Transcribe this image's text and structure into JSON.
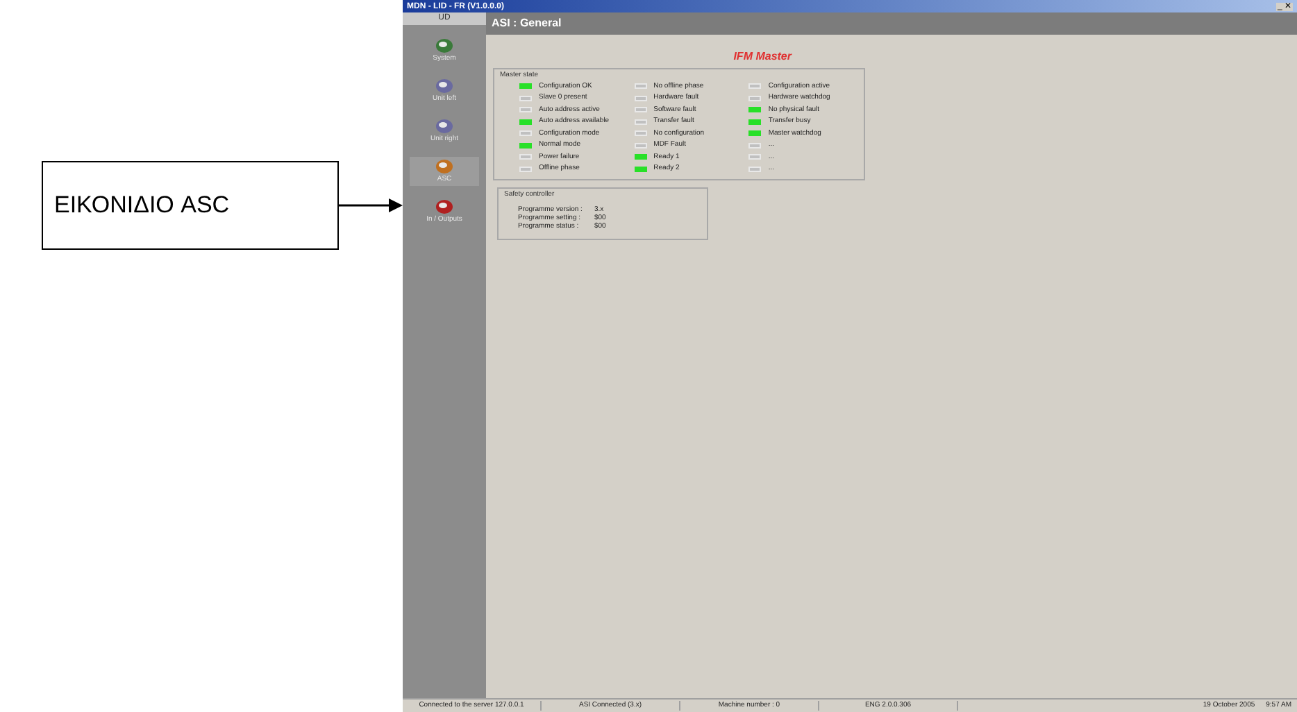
{
  "callout": {
    "label": "ΕΙΚΟΝΙΔΙΟ ASC"
  },
  "window": {
    "title": "MDN - LID - FR (V1.0.0.0)",
    "controls": "_ ✕"
  },
  "sidebar": {
    "header": "UD",
    "items": [
      {
        "label": "System",
        "selected": false
      },
      {
        "label": "Unit left",
        "selected": false
      },
      {
        "label": "Unit right",
        "selected": false
      },
      {
        "label": "ASC",
        "selected": true
      },
      {
        "label": "In / Outputs",
        "selected": false
      }
    ]
  },
  "page_header": "ASI : General",
  "brand": "IFM Master",
  "master_state": {
    "title": "Master state",
    "columns": [
      [
        {
          "label": "Configuration OK",
          "on": true
        },
        {
          "label": "Slave 0 present",
          "on": false
        },
        {
          "label": "Auto address active",
          "on": false
        },
        {
          "label": "Auto address available",
          "on": true
        },
        {
          "label": "Configuration mode",
          "on": false
        },
        {
          "label": "Normal mode",
          "on": true
        },
        {
          "label": "Power failure",
          "on": false
        },
        {
          "label": "Offline phase",
          "on": false
        }
      ],
      [
        {
          "label": "No offline phase",
          "on": false
        },
        {
          "label": "Hardware fault",
          "on": false
        },
        {
          "label": "Software fault",
          "on": false
        },
        {
          "label": "Transfer fault",
          "on": false
        },
        {
          "label": "No configuration",
          "on": false
        },
        {
          "label": "MDF Fault",
          "on": false
        },
        {
          "label": "Ready 1",
          "on": true
        },
        {
          "label": "Ready 2",
          "on": true
        }
      ],
      [
        {
          "label": "Configuration active",
          "on": false
        },
        {
          "label": "Hardware watchdog",
          "on": false
        },
        {
          "label": "No physical fault",
          "on": true
        },
        {
          "label": "Transfer busy",
          "on": true
        },
        {
          "label": "Master watchdog",
          "on": true
        },
        {
          "label": "...",
          "on": false
        },
        {
          "label": "...",
          "on": false
        },
        {
          "label": "...",
          "on": false
        }
      ]
    ]
  },
  "safety_controller": {
    "title": "Safety controller",
    "rows": [
      {
        "label": "Programme version :",
        "value": "3.x"
      },
      {
        "label": "Programme setting :",
        "value": "$00"
      },
      {
        "label": "Programme status :",
        "value": "$00"
      }
    ]
  },
  "status_bar": [
    "Connected to the server 127.0.0.1",
    "ASI Connected (3.x)",
    "Machine number : 0",
    "ENG 2.0.0.306",
    "19 October 2005",
    "9:57 AM"
  ]
}
